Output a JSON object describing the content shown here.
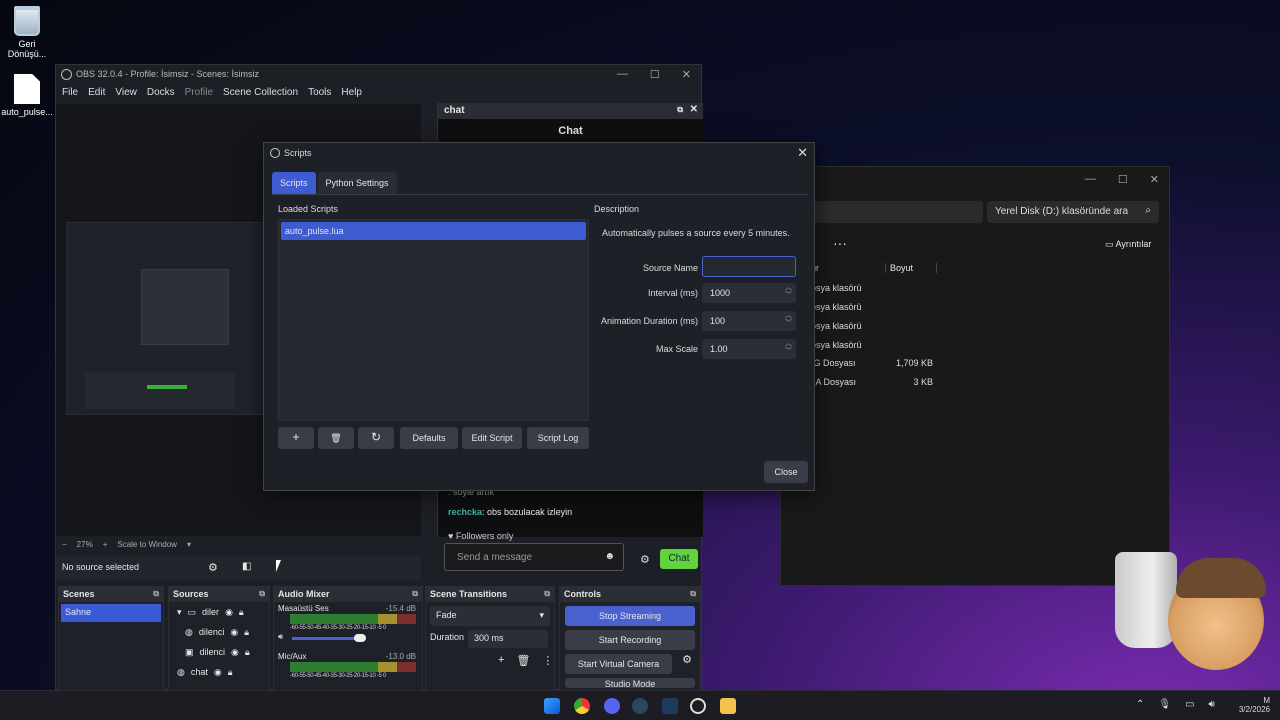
{
  "desktop": {
    "icons": [
      {
        "label": "Geri Dönüşü..."
      },
      {
        "label": "auto_pulse..."
      }
    ]
  },
  "explorer": {
    "search_placeholder": "Yerel Disk (D:) klasöründe ara",
    "details_label": "Ayrıntılar",
    "columns": {
      "type": "ür",
      "size": "Boyut"
    },
    "rows": [
      {
        "type": "osya klasörü",
        "size": ""
      },
      {
        "type": "osya klasörü",
        "size": ""
      },
      {
        "type": "osya klasörü",
        "size": ""
      },
      {
        "type": "osya klasörü",
        "size": ""
      },
      {
        "type": "IG Dosyası",
        "size": "1,709 KB"
      },
      {
        "type": "JA Dosyası",
        "size": "3 KB"
      }
    ]
  },
  "obs": {
    "title": "OBS 32.0.4 - Profile: İsimsiz - Scenes: İsimsiz",
    "menu": [
      "File",
      "Edit",
      "View",
      "Docks",
      "Profile",
      "Scene Collection",
      "Tools",
      "Help"
    ],
    "zoom": {
      "minus": "−",
      "value": "27%",
      "plus": "+",
      "mode": "Scale to Window"
    },
    "no_source": "No source selected",
    "chat_dock": {
      "title": "chat",
      "header": "Chat",
      "msg1_user": "rechcka",
      "msg1_text": ": obs bozulacak izleyin",
      "msg0_text": ": söyle artık",
      "followers": "Followers only",
      "placeholder": "Send a message",
      "send": "Chat"
    },
    "docks": {
      "scenes": {
        "title": "Scenes",
        "items": [
          "Sahne"
        ]
      },
      "sources": {
        "title": "Sources",
        "items": [
          "diler",
          "dilenci",
          "dilenci",
          "chat"
        ]
      },
      "mixer": {
        "title": "Audio Mixer",
        "channels": [
          {
            "name": "Masaüstü Ses",
            "db": "-15.4 dB"
          },
          {
            "name": "Mic/Aux",
            "db": "-13.0 dB"
          }
        ],
        "ticks": "-60-55-50-45-40-35-30-25-20-15-10 -5  0"
      },
      "transitions": {
        "title": "Scene Transitions",
        "type": "Fade",
        "duration_label": "Duration",
        "duration": "300 ms"
      },
      "controls": {
        "title": "Controls",
        "buttons": [
          "Stop Streaming",
          "Start Recording",
          "Start Virtual Camera",
          "Studio Mode"
        ]
      }
    }
  },
  "scripts": {
    "title": "Scripts",
    "tabs": [
      "Scripts",
      "Python Settings"
    ],
    "loaded_label": "Loaded Scripts",
    "items": [
      "auto_pulse.lua"
    ],
    "description_label": "Description",
    "description": "Automatically pulses a source every 5 minutes.",
    "fields": [
      {
        "label": "Source Name",
        "value": ""
      },
      {
        "label": "Interval (ms)",
        "value": "1000"
      },
      {
        "label": "Animation Duration (ms)",
        "value": "100"
      },
      {
        "label": "Max Scale",
        "value": "1.00"
      }
    ],
    "buttons": {
      "add": "+",
      "remove": "🗑",
      "reload": "↻",
      "defaults": "Defaults",
      "edit": "Edit Script",
      "log": "Script Log"
    },
    "close": "Close"
  },
  "taskbar": {
    "date": "3/2/2026",
    "time": "M"
  }
}
